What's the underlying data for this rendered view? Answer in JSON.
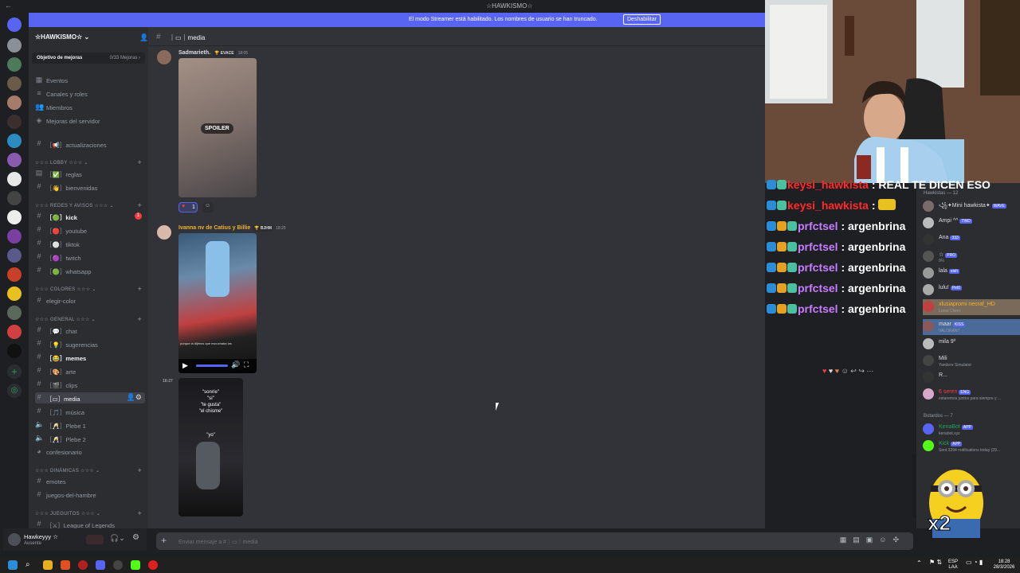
{
  "titlebar": {
    "title": "☆HAWKISMO☆",
    "back_glyph": "←"
  },
  "banner": {
    "message": "El modo Streamer está habilitado. Los nombres de usuario se han truncado.",
    "button": "Deshabilitar"
  },
  "server": {
    "name": "☆HAWKISMO☆",
    "goal_label": "Objetivo de mejoras",
    "goal_progress": "0/33 Mejoras ›"
  },
  "nav_items": [
    {
      "label": "Eventos",
      "icon": "calendar-icon"
    },
    {
      "label": "Canales y roles",
      "icon": "list-icon"
    },
    {
      "label": "Miembros",
      "icon": "members-icon"
    },
    {
      "label": "Mejoras del servidor",
      "icon": "boost-icon"
    }
  ],
  "categories": {
    "lobby": "☆☆☆ LOBBY ☆☆☆ ⌄",
    "redes": "☆☆☆ REDES Y AVISOS ☆☆☆ ⌄",
    "colores": "☆☆☆ COLORES ☆☆☆ ⌄",
    "general": "☆☆☆ GENERAL ☆☆☆ ⌄",
    "dinamicas": "☆☆☆ DINÁMICAS ☆☆☆ ⌄",
    "juegos": "☆☆☆ JUEGUITOS ☆☆☆ ⌄"
  },
  "channels": {
    "actualizaciones": "actualizaciones",
    "reglas": "reglas",
    "bienvenidas": "bienvenidas",
    "kick": "kick",
    "kick_badge": "1",
    "youtube": "youtube",
    "tiktok": "tiktok",
    "twitch": "twitch",
    "whatsapp": "whatsapp",
    "elegir_color": "elegir-color",
    "chat": "chat",
    "sugerencias": "sugerencias",
    "memes": "memes",
    "arte": "arte",
    "clips": "clips",
    "media": "media",
    "musica": "música",
    "plebe1": "Plebe 1",
    "plebe2": "Plebe 2",
    "confesionario": "confesionario",
    "emotes": "emotes",
    "juegos_hambre": "juegos-del-hambre",
    "lol": "League of Legends"
  },
  "user": {
    "name": "Hawkeyyy ☆",
    "status": "Ausente"
  },
  "chat_header": {
    "channel": "｜▭｜media"
  },
  "messages": [
    {
      "author": "Sadmarieth.",
      "tag": "🏆 EVACE",
      "time": "18:05",
      "spoiler": "SPOILER",
      "reaction_count": "1"
    },
    {
      "author": "Ivanna nv de Catius y Billie",
      "tag": "🏆 BJHM",
      "time": "18:25",
      "caption": "porque la dijimos que escuchaba las"
    },
    {
      "time": "18:27",
      "phone_lines": [
        "\"sonríe\"",
        "\"sí\"",
        "\"te gusta\"",
        "\"el chisme\"",
        "\"yo\""
      ]
    }
  ],
  "composer": {
    "placeholder": "Enviar mensaje a #｜▭｜media"
  },
  "overlay_chat": [
    {
      "user": "keysi_hawkista",
      "msg": " : REAL TE DICEN ESO",
      "red": true
    },
    {
      "user": "keysi_hawkista",
      "msg": " : ",
      "red": true
    },
    {
      "user": "prfctsel",
      "msg": " : argenbrina",
      "red": false
    },
    {
      "user": "prfctsel",
      "msg": " : argenbrina",
      "red": false
    },
    {
      "user": "prfctsel",
      "msg": " : argenbrina",
      "red": false
    },
    {
      "user": "prfctsel",
      "msg": " : argenbrina",
      "red": false
    },
    {
      "user": "prfctsel",
      "msg": " : argenbrina",
      "red": false
    }
  ],
  "members": {
    "group1": "Hawkistas — 12",
    "list": [
      {
        "name": "꧁✦Mini hawkista✦",
        "badge": "WAVE",
        "sub": "",
        "color": "#dbdee1"
      },
      {
        "name": "Ampi ^^",
        "badge": "TWD",
        "sub": "",
        "color": "#dbdee1"
      },
      {
        "name": "Ana",
        "badge": "333",
        "sub": "",
        "color": "#dbdee1"
      },
      {
        "name": "☆",
        "badge": "PRO",
        "sub": "9¼",
        "color": "#dbdee1"
      },
      {
        "name": "lala",
        "badge": "eish",
        "sub": "",
        "color": "#dbdee1"
      },
      {
        "name": "lulu!",
        "badge": "Pel0",
        "sub": "",
        "color": "#dbdee1"
      },
      {
        "name": "xlusiapromi necraf_HD",
        "badge": "",
        "sub": "Lunar Client",
        "color": "#f0b232"
      },
      {
        "name": "maar",
        "badge": "KISS",
        "sub": "VALORANT",
        "color": "#dbdee1"
      },
      {
        "name": "mila 9º",
        "badge": "",
        "sub": "",
        "color": "#dbdee1"
      },
      {
        "name": "Mili",
        "badge": "",
        "sub": "Yandere Simulator",
        "color": "#dbdee1"
      },
      {
        "name": "R...",
        "badge": "",
        "sub": "",
        "color": "#dbdee1"
      },
      {
        "name": "6 seren",
        "badge": "ENG",
        "sub": "estaremos juntos para siempre y ...",
        "color": "#f23f43"
      }
    ],
    "group2": "Botardos — 7",
    "bots": [
      {
        "name": "KenaBot",
        "badge": "APP",
        "sub": "kenabot.xyz",
        "color": "#23a55a"
      },
      {
        "name": "Kick",
        "badge": "APP",
        "sub": "Sent 3294 notifications today (29...",
        "color": "#23a55a"
      }
    ],
    "minion_text": "x2"
  },
  "taskbar": {
    "lang": "ESP LAA",
    "time": "18:28",
    "date": "28/3/2026"
  },
  "colors": {
    "blurple": "#5865f2",
    "bg": "#313338",
    "sidebar": "#2b2d31"
  }
}
